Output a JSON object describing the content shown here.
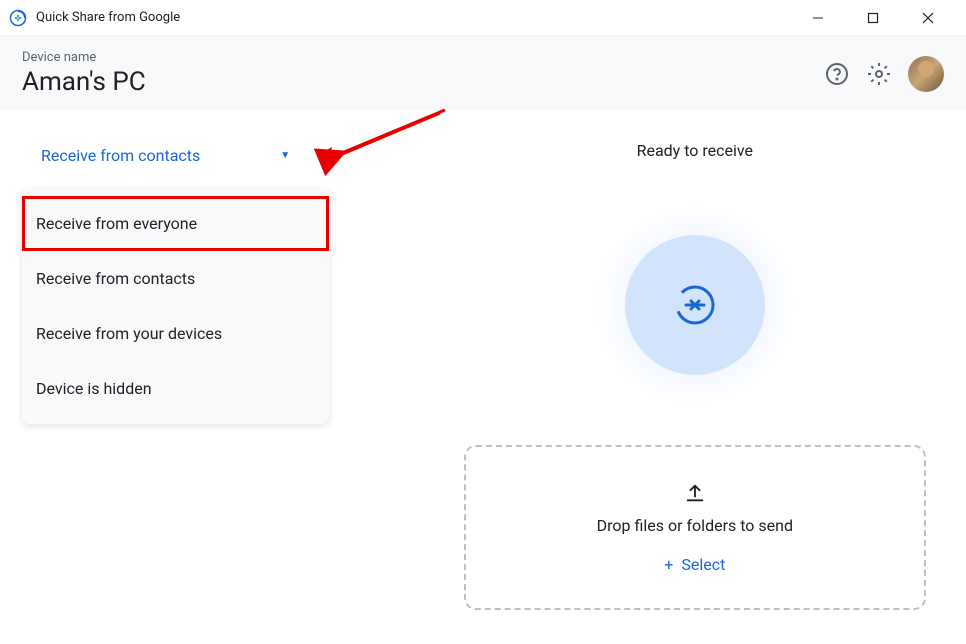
{
  "titleBar": {
    "title": "Quick Share from Google"
  },
  "header": {
    "deviceLabel": "Device name",
    "deviceName": "Aman's PC"
  },
  "dropdown": {
    "selectedLabel": "Receive from contacts",
    "options": [
      {
        "label": "Receive from everyone",
        "highlighted": true
      },
      {
        "label": "Receive from contacts",
        "highlighted": false
      },
      {
        "label": "Receive from your devices",
        "highlighted": false
      },
      {
        "label": "Device is hidden",
        "highlighted": false
      }
    ]
  },
  "main": {
    "statusText": "Ready to receive",
    "dropText": "Drop files or folders to send",
    "selectLabel": "Select"
  },
  "colors": {
    "primary": "#1967d2",
    "highlight": "#e60000"
  }
}
